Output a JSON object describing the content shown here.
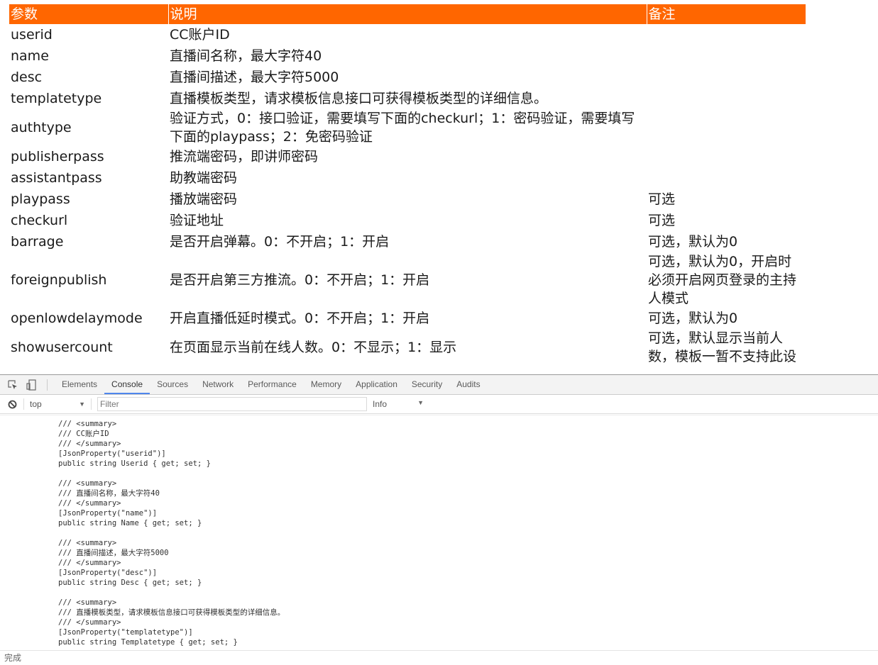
{
  "table": {
    "headers": [
      "参数",
      "说明",
      "备注"
    ],
    "rows": [
      {
        "param": "userid",
        "desc": "CC账户ID",
        "note": ""
      },
      {
        "param": "name",
        "desc": "直播间名称，最大字符40",
        "note": ""
      },
      {
        "param": "desc",
        "desc": "直播间描述，最大字符5000",
        "note": ""
      },
      {
        "param": "templatetype",
        "desc": "直播模板类型，请求模板信息接口可获得模板类型的详细信息。",
        "note": ""
      },
      {
        "param": "authtype",
        "desc": "验证方式，0：接口验证，需要填写下面的checkurl；1：密码验证，需要填写下面的playpass；2：免密码验证",
        "note": ""
      },
      {
        "param": "publisherpass",
        "desc": "推流端密码，即讲师密码",
        "note": ""
      },
      {
        "param": "assistantpass",
        "desc": "助教端密码",
        "note": ""
      },
      {
        "param": "playpass",
        "desc": "播放端密码",
        "note": "可选"
      },
      {
        "param": "checkurl",
        "desc": "验证地址",
        "note": "可选"
      },
      {
        "param": "barrage",
        "desc": "是否开启弹幕。0：不开启；1：开启",
        "note": "可选，默认为0"
      },
      {
        "param": "foreignpublish",
        "desc": "是否开启第三方推流。0：不开启；1：开启",
        "note": "可选，默认为0，开启时必须开启网页登录的主持人模式"
      },
      {
        "param": "openlowdelaymode",
        "desc": "开启直播低延时模式。0：不开启；1：开启",
        "note": "可选，默认为0"
      },
      {
        "param": "showusercount",
        "desc": "在页面显示当前在线人数。0：不显示；1：显示",
        "note": "可选，默认显示当前人数，模板一暂不支持此设"
      }
    ]
  },
  "devtools": {
    "toolbar_icons": [
      "inspect-element-icon",
      "device-toolbar-icon"
    ],
    "tabs": [
      "Elements",
      "Console",
      "Sources",
      "Network",
      "Performance",
      "Memory",
      "Application",
      "Security",
      "Audits"
    ],
    "active_tab": "Console",
    "context": "top",
    "filter_placeholder": "Filter",
    "filter_value": "",
    "level": "Info",
    "console_output": "/// <summary>\n/// CC账户ID\n/// </summary>\n[JsonProperty(\"userid\")]\npublic string Userid { get; set; }\n\n/// <summary>\n/// 直播间名称，最大字符40\n/// </summary>\n[JsonProperty(\"name\")]\npublic string Name { get; set; }\n\n/// <summary>\n/// 直播间描述，最大字符5000\n/// </summary>\n[JsonProperty(\"desc\")]\npublic string Desc { get; set; }\n\n/// <summary>\n/// 直播模板类型，请求模板信息接口可获得模板类型的详细信息。\n/// </summary>\n[JsonProperty(\"templatetype\")]\npublic string Templatetype { get; set; }"
  },
  "status_bar": {
    "text": "完成"
  },
  "colors": {
    "header_bg": "#ff6600",
    "header_text": "#ffffff",
    "active_tab_underline": "#4f86ec"
  }
}
